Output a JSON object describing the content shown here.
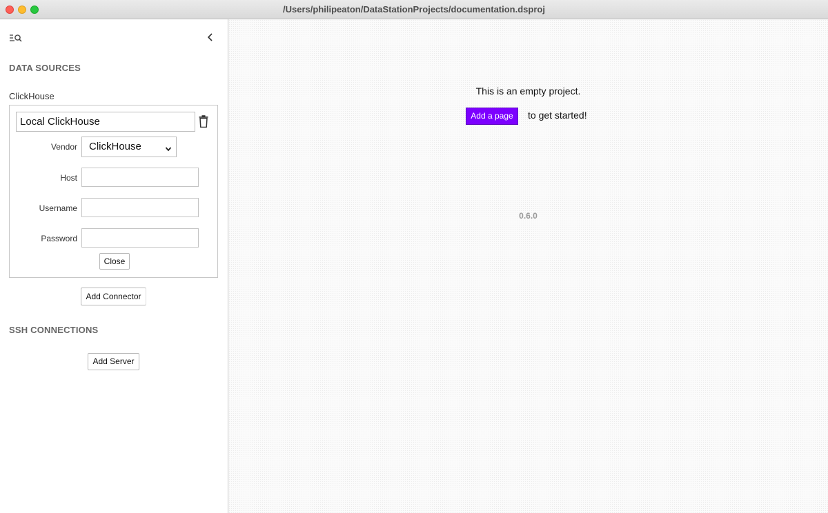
{
  "window": {
    "title": "/Users/philipeaton/DataStationProjects/documentation.dsproj"
  },
  "sidebar": {
    "data_sources_title": "DATA SOURCES",
    "source": {
      "type_label": "ClickHouse",
      "name": "Local ClickHouse",
      "vendor_label": "Vendor",
      "vendor_value": "ClickHouse",
      "host_label": "Host",
      "host_value": "",
      "username_label": "Username",
      "username_value": "",
      "password_label": "Password",
      "password_value": "",
      "close_label": "Close"
    },
    "add_connector_label": "Add Connector",
    "ssh_title": "SSH CONNECTIONS",
    "add_server_label": "Add Server"
  },
  "main": {
    "empty_text": "This is an empty project.",
    "add_page_label": "Add a page",
    "get_started_text": "to get started!",
    "version": "0.6.0"
  },
  "colors": {
    "accent": "#7c00ff"
  },
  "icons": [
    "search-icon",
    "chevron-left-icon",
    "trash-icon",
    "chevron-down-icon"
  ]
}
